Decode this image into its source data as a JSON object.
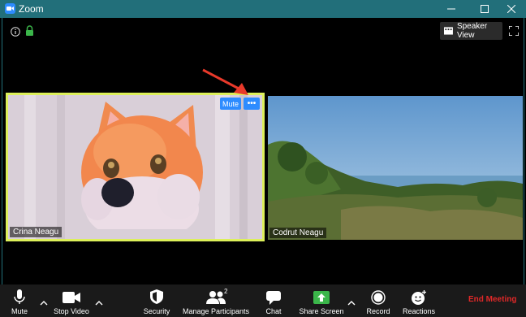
{
  "window": {
    "title": "Zoom"
  },
  "top": {
    "speaker_view_label": "Speaker View"
  },
  "participants": [
    {
      "name": "Crina Neagu",
      "active": true,
      "mute_label": "Mute",
      "more_label": "•••"
    },
    {
      "name": "Codrut Neagu",
      "active": false
    }
  ],
  "toolbar": {
    "mute": "Mute",
    "stop_video": "Stop Video",
    "security": "Security",
    "manage_participants": "Manage Participants",
    "participant_count": "2",
    "chat": "Chat",
    "share_screen": "Share Screen",
    "record": "Record",
    "reactions": "Reactions",
    "end_meeting": "End Meeting"
  },
  "colors": {
    "titlebar": "#226f7a",
    "active_border": "#ddf05a",
    "accent": "#2d8cff",
    "share_green": "#3bb64a",
    "end_red": "#e02828",
    "annotation_arrow": "#e8392a"
  }
}
